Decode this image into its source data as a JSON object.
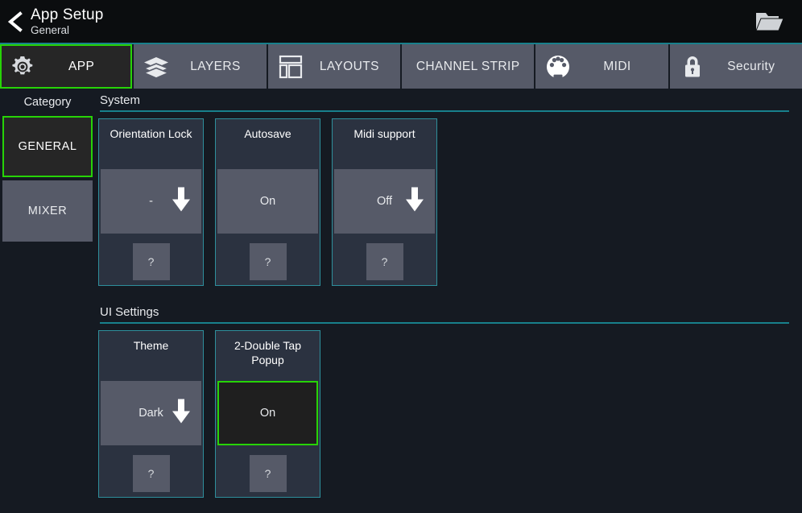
{
  "header": {
    "title": "App Setup",
    "subtitle": "General",
    "back_icon": "back-chevron-icon",
    "folder_icon": "folder-icon"
  },
  "tabs": [
    {
      "label": "APP",
      "icon": "gear-icon",
      "selected": true
    },
    {
      "label": "LAYERS",
      "icon": "layers-icon",
      "selected": false
    },
    {
      "label": "LAYOUTS",
      "icon": "layout-grid-icon",
      "selected": false
    },
    {
      "label": "CHANNEL STRIP",
      "icon": "",
      "selected": false
    },
    {
      "label": "MIDI",
      "icon": "midi-din-icon",
      "selected": false
    },
    {
      "label": "Security",
      "icon": "padlock-icon",
      "selected": false
    }
  ],
  "sidebar": {
    "heading": "Category",
    "items": [
      {
        "label": "GENERAL",
        "selected": true
      },
      {
        "label": "MIXER",
        "selected": false
      }
    ]
  },
  "sections": [
    {
      "title": "System",
      "cards": [
        {
          "title": "Orientation Lock",
          "value": "-",
          "arrow": true,
          "highlight": false,
          "help": "?"
        },
        {
          "title": "Autosave",
          "value": "On",
          "arrow": false,
          "highlight": false,
          "help": "?"
        },
        {
          "title": "Midi support",
          "value": "Off",
          "arrow": true,
          "highlight": false,
          "help": "?"
        }
      ]
    },
    {
      "title": "UI Settings",
      "cards": [
        {
          "title": "Theme",
          "value": "Dark",
          "arrow": true,
          "highlight": false,
          "help": "?"
        },
        {
          "title": "2-Double Tap Popup",
          "value": "On",
          "arrow": false,
          "highlight": true,
          "help": "?"
        }
      ]
    }
  ],
  "colors": {
    "accent_green": "#27d307",
    "accent_teal": "#2e8f9c",
    "page_bg": "#151a22",
    "card_bg": "#2b3240",
    "control_gray": "#565a68"
  }
}
